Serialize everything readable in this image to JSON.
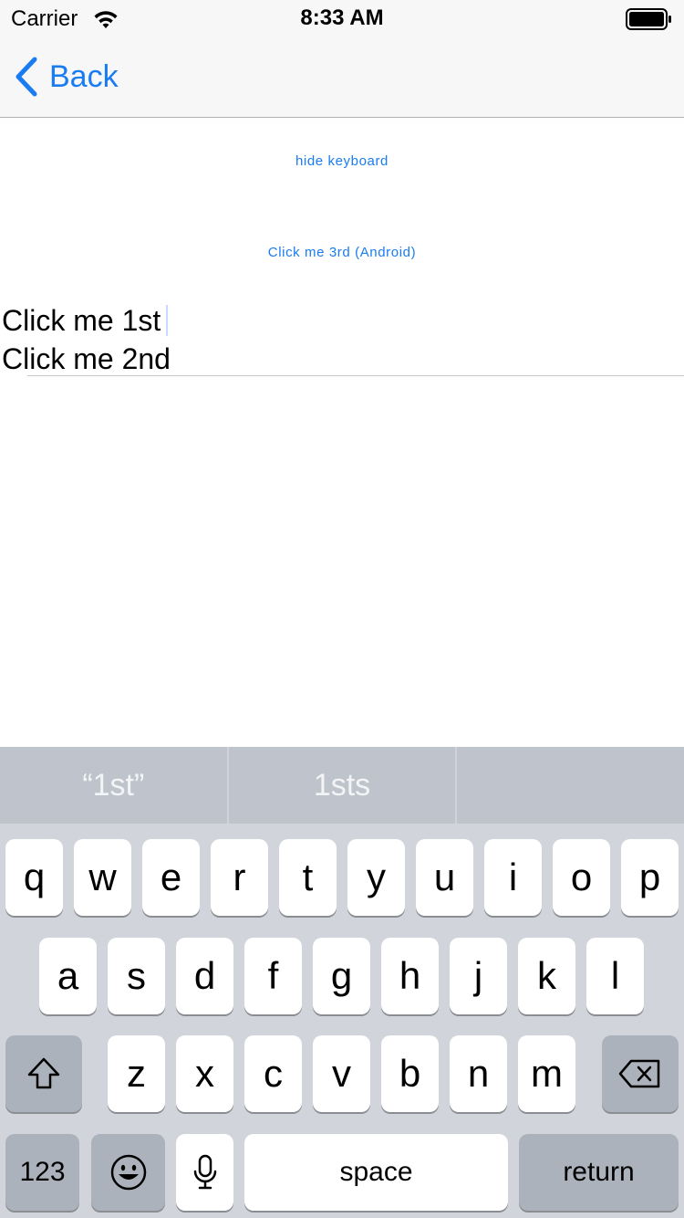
{
  "status_bar": {
    "carrier": "Carrier",
    "time": "8:33 AM",
    "wifi_icon": "wifi-icon",
    "battery_icon": "battery-icon"
  },
  "nav": {
    "back_label": "Back",
    "back_icon": "chevron-left-icon",
    "accent_color": "#1a7cf2"
  },
  "content": {
    "hide_keyboard_label": "hide keyboard",
    "click_third_label": "Click me 3rd (Android)",
    "text_lines": [
      "Click me 1st",
      "Click me 2nd"
    ]
  },
  "keyboard": {
    "suggestions": [
      "“1st”",
      "1sts",
      ""
    ],
    "row1": [
      "q",
      "w",
      "e",
      "r",
      "t",
      "y",
      "u",
      "i",
      "o",
      "p"
    ],
    "row2": [
      "a",
      "s",
      "d",
      "f",
      "g",
      "h",
      "j",
      "k",
      "l"
    ],
    "row3": [
      "z",
      "x",
      "c",
      "v",
      "b",
      "n",
      "m"
    ],
    "shift_icon": "shift-icon",
    "delete_icon": "delete-icon",
    "numbers_label": "123",
    "emoji_icon": "emoji-icon",
    "mic_icon": "microphone-icon",
    "space_label": "space",
    "return_label": "return"
  }
}
